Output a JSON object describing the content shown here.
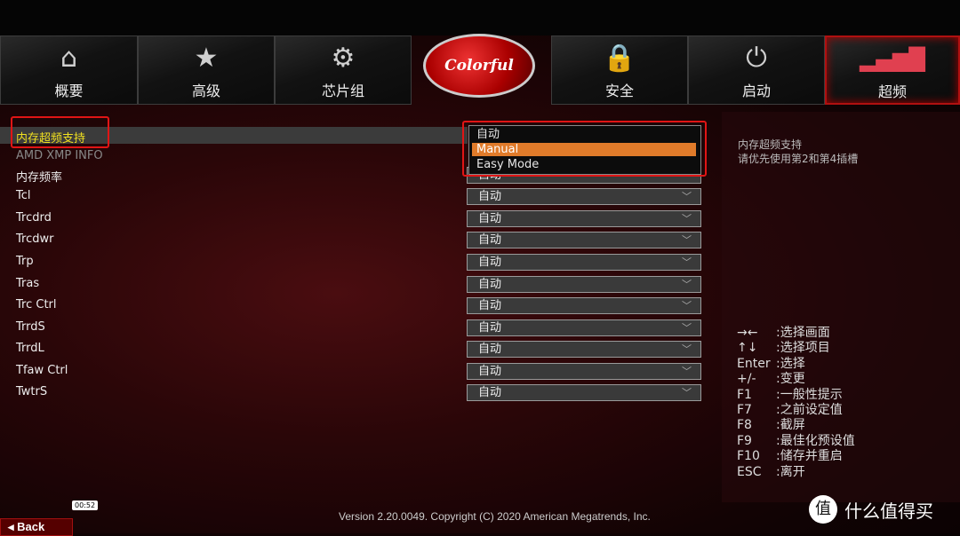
{
  "tabs": [
    {
      "label": "概要",
      "icon": "home-icon",
      "glyph": "⌂"
    },
    {
      "label": "高级",
      "icon": "star-icon",
      "glyph": "★"
    },
    {
      "label": "芯片组",
      "icon": "gears-icon",
      "glyph": "⚙"
    },
    {
      "label": "安全",
      "icon": "lock-icon",
      "glyph": "🔒"
    },
    {
      "label": "启动",
      "icon": "power-icon",
      "glyph": "⏻"
    },
    {
      "label": "超频",
      "icon": "bars-icon",
      "glyph": "▂▄▆█"
    }
  ],
  "active_tab": "超频",
  "logo": "Colorful",
  "settings": [
    {
      "label": "内存超频支持",
      "value": "Manual",
      "selected": true
    },
    {
      "label": "AMD XMP INFO",
      "disabled": true
    },
    {
      "label": "内存频率",
      "value": "自动"
    },
    {
      "label": "Tcl",
      "value": "自动"
    },
    {
      "label": "Trcdrd",
      "value": "自动"
    },
    {
      "label": "Trcdwr",
      "value": "自动"
    },
    {
      "label": "Trp",
      "value": "自动"
    },
    {
      "label": "Tras",
      "value": "自动"
    },
    {
      "label": "Trc Ctrl",
      "value": "自动"
    },
    {
      "label": "TrrdS",
      "value": "自动"
    },
    {
      "label": "TrrdL",
      "value": "自动"
    },
    {
      "label": "Tfaw Ctrl",
      "value": "自动"
    },
    {
      "label": "TwtrS",
      "value": "自动"
    }
  ],
  "popup": {
    "options": [
      "自动",
      "Manual",
      "Easy Mode"
    ],
    "highlighted": "Manual"
  },
  "help": {
    "line1": "内存超频支持",
    "line2": "请优先使用第2和第4插槽"
  },
  "keys": [
    {
      "key": "→←",
      "desc": ":选择画面"
    },
    {
      "key": "↑↓",
      "desc": ":选择项目"
    },
    {
      "key": "Enter",
      "desc": ":选择"
    },
    {
      "key": "+/-",
      "desc": ":变更"
    },
    {
      "key": "F1",
      "desc": ":一般性提示"
    },
    {
      "key": "F7",
      "desc": ":之前设定值"
    },
    {
      "key": "F8",
      "desc": ":截屏"
    },
    {
      "key": "F9",
      "desc": ":最佳化预设值"
    },
    {
      "key": "F10",
      "desc": ":储存并重启"
    },
    {
      "key": "ESC",
      "desc": ":离开"
    }
  ],
  "footer": {
    "version": "Version 2.20.0049. Copyright (C) 2020 American Megatrends, Inc.",
    "back": "◂ Back",
    "time": "00:52",
    "watermark_icon": "值",
    "watermark": "什么值得买"
  },
  "colors": {
    "highlight": "#e07b2a",
    "selected_text": "#f0e020",
    "annotation": "#e01515"
  }
}
